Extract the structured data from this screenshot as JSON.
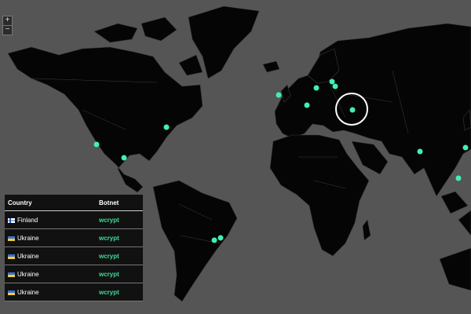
{
  "zoom": {
    "in_label": "+",
    "out_label": "−"
  },
  "table": {
    "columns": [
      "Country",
      "Botnet"
    ],
    "rows": [
      {
        "country": "Finland",
        "flag": "finland-flag-icon",
        "botnet": "wcrypt"
      },
      {
        "country": "Ukraine",
        "flag": "ukraine-flag-icon",
        "botnet": "wcrypt"
      },
      {
        "country": "Ukraine",
        "flag": "ukraine-flag-icon",
        "botnet": "wcrypt"
      },
      {
        "country": "Ukraine",
        "flag": "ukraine-flag-icon",
        "botnet": "wcrypt"
      },
      {
        "country": "Ukraine",
        "flag": "ukraine-flag-icon",
        "botnet": "wcrypt"
      }
    ]
  },
  "colors": {
    "ocean": "#555555",
    "land": "#050505",
    "marker": "#3ff0b4",
    "highlight_ring": "#ffffff",
    "botnet_text": "#3ddc97"
  },
  "markers": {
    "count": 14,
    "highlighted": "Ukraine"
  }
}
